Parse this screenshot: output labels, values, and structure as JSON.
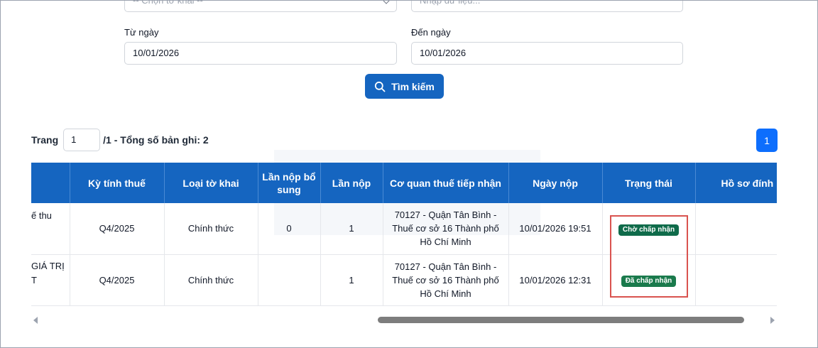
{
  "filters": {
    "declaration_select": {
      "placeholder": "-- Chọn tờ khai --"
    },
    "data_input": {
      "placeholder": "Nhập dữ liệu..."
    },
    "from_date": {
      "label": "Từ ngày",
      "value": "10/01/2026"
    },
    "to_date": {
      "label": "Đến ngày",
      "value": "10/01/2026"
    },
    "search_button": {
      "label": "Tìm kiếm",
      "icon": "search-icon"
    }
  },
  "pager": {
    "prefix": "Trang",
    "current_page": "1",
    "summary": "/1 - Tổng số bản ghi: 2",
    "page_button": "1"
  },
  "table": {
    "headers": [
      "",
      "Kỳ tính thuế",
      "Loại tờ khai",
      "Lần nộp bổ sung",
      "Lần nộp",
      "Cơ quan thuế tiếp nhận",
      "Ngày nộp",
      "Trạng thái",
      "Hồ sơ đính kèm"
    ],
    "rows": [
      {
        "name_fragment": "ế thu",
        "period": "Q4/2025",
        "type": "Chính thức",
        "supplement": "0",
        "submission": "1",
        "tax_office": "70127 - Quận Tân Bình - Thuế cơ sở 16 Thành phố Hồ Chí Minh",
        "date": "10/01/2026 19:51",
        "status": "Chờ chấp nhận",
        "status_color": "#0f6b4a",
        "attachment": ""
      },
      {
        "name_fragment": "GIÁ TRỊ\nT",
        "period": "Q4/2025",
        "type": "Chính thức",
        "supplement": "",
        "submission": "1",
        "tax_office": "70127 - Quận Tân Bình - Thuế cơ sở 16 Thành phố Hồ Chí Minh",
        "date": "10/01/2026 12:31",
        "status": "Đã chấp nhận",
        "status_color": "#1a7a4c",
        "attachment": ""
      }
    ]
  },
  "colors": {
    "primary": "#1565c0",
    "page_button": "#0d6efd",
    "highlight_border": "#d9534f"
  }
}
